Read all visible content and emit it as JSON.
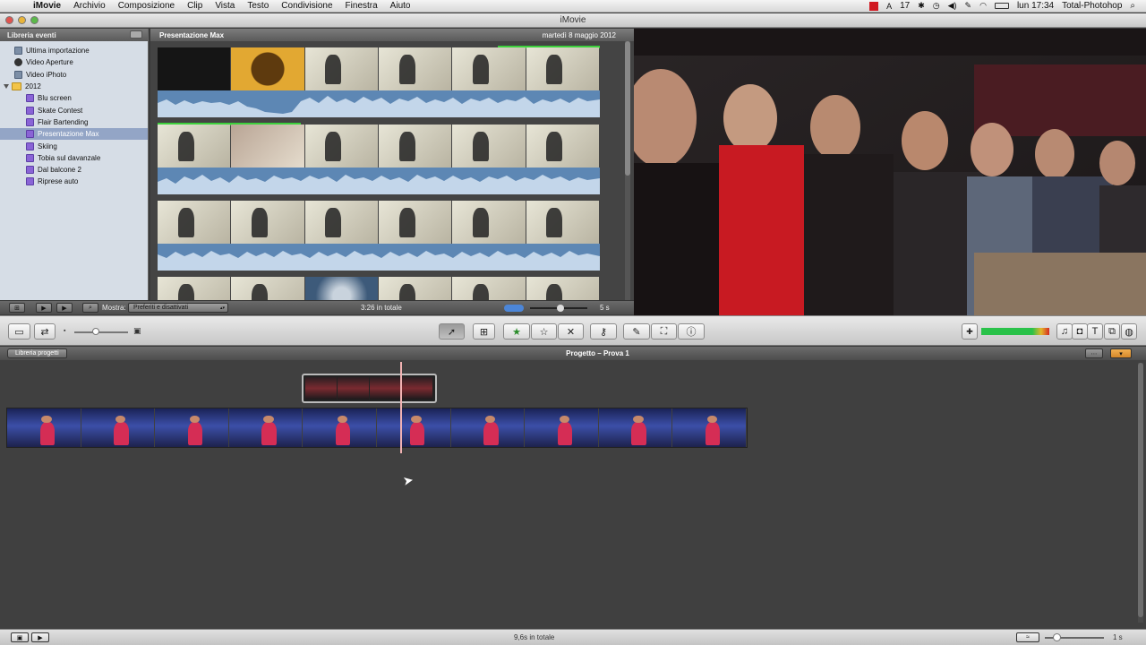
{
  "menubar": {
    "apple": "",
    "items": [
      "iMovie",
      "Archivio",
      "Composizione",
      "Clip",
      "Vista",
      "Testo",
      "Condivisione",
      "Finestra",
      "Aiuto"
    ],
    "status_date": "17",
    "clock": "lun 17:34",
    "user": "Total-Photohop"
  },
  "window": {
    "title": "iMovie"
  },
  "event_library": {
    "title": "Libreria eventi",
    "top_items": [
      "Ultima importazione",
      "Video Aperture",
      "Video iPhoto"
    ],
    "year": "2012",
    "events": [
      "Blu screen",
      "Skate Contest",
      "Flair Bartending",
      "Presentazione Max",
      "Skiing",
      "Tobia sul davanzale",
      "Dal balcone 2",
      "Riprese auto"
    ],
    "selected": "Presentazione Max"
  },
  "event_browser": {
    "title": "Presentazione Max",
    "date": "martedì 8 maggio 2012"
  },
  "event_toolbar": {
    "show_label": "Mostra:",
    "filter": "Preferiti e disattivati",
    "total": "3:26 in totale",
    "zoom": "5 s"
  },
  "project": {
    "back_label": "Libreria progetti",
    "title": "Progetto – Prova 1"
  },
  "statusbar": {
    "total": "9,6s in totale",
    "zoom": "1 s"
  },
  "colors": {
    "accent_selection": "#93a5c6",
    "favorite_green": "#3dd13d",
    "playhead": "#f2b3b3",
    "waveform": "#5d87b4"
  }
}
